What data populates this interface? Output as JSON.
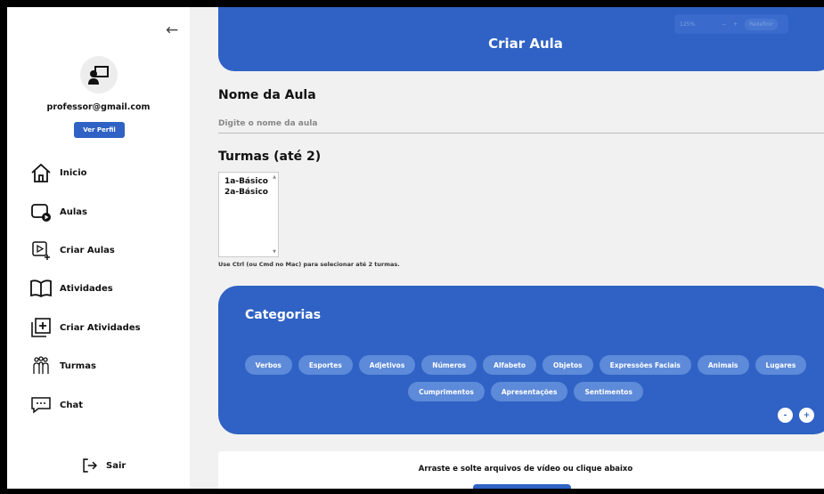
{
  "sidebar": {
    "email": "professor@gmail.com",
    "profile_button": "Ver Perfil",
    "items": [
      {
        "label": "Inicio",
        "icon": "home-icon"
      },
      {
        "label": "Aulas",
        "icon": "video-icon"
      },
      {
        "label": "Criar Aulas",
        "icon": "add-video-icon"
      },
      {
        "label": "Atividades",
        "icon": "book-icon"
      },
      {
        "label": "Criar Atividades",
        "icon": "add-box-icon"
      },
      {
        "label": "Turmas",
        "icon": "group-icon"
      },
      {
        "label": "Chat",
        "icon": "chat-icon"
      }
    ],
    "logout": "Sair"
  },
  "zoom": {
    "level": "125%",
    "minus": "−",
    "plus": "+",
    "reset": "Redefinir"
  },
  "header": {
    "title": "Criar Aula"
  },
  "form": {
    "aula_label": "Nome da Aula",
    "aula_placeholder": "Digite o nome da aula",
    "turmas_label": "Turmas (até 2)",
    "turmas_options": [
      "1a-Básico",
      "2a-Básico"
    ],
    "turmas_hint": "Use Ctrl (ou Cmd no Mac) para selecionar até 2 turmas."
  },
  "categorias": {
    "title": "Categorias",
    "chips": [
      "Verbos",
      "Esportes",
      "Adjetivos",
      "Números",
      "Alfabeto",
      "Objetos",
      "Expressões Faciais",
      "Animais",
      "Lugares",
      "Cumprimentos",
      "Apresentações",
      "Sentimentos"
    ],
    "minus": "-",
    "plus": "+"
  },
  "upload": {
    "text": "Arraste e solte arquivos de vídeo ou clique abaixo"
  },
  "colors": {
    "primary": "#2f62c4",
    "chip": "#5d8ad9"
  }
}
